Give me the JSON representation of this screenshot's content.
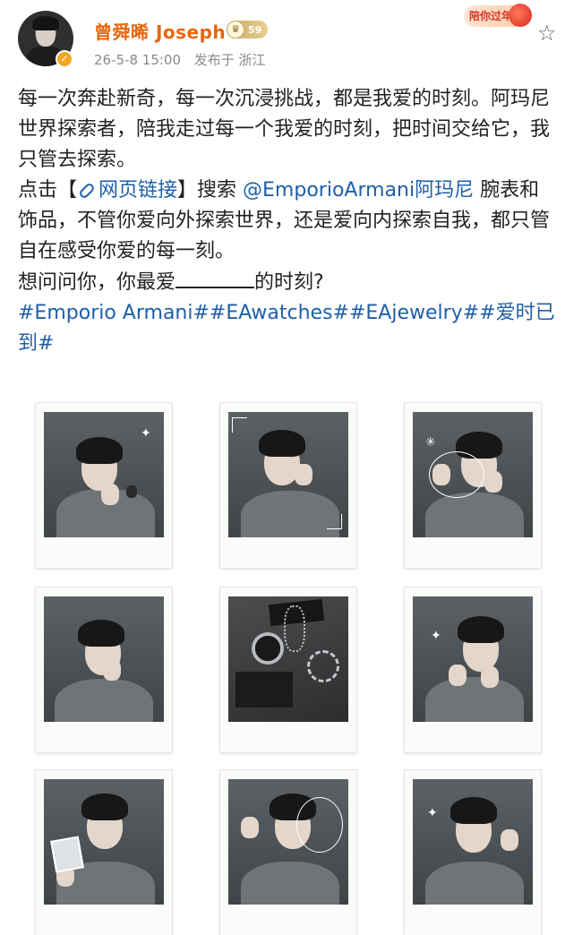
{
  "post": {
    "username": "曾舜晞 Joseph",
    "level": "59",
    "verified_symbol": "✓",
    "festival_badge": "陪你过年",
    "favorite_symbol": "☆",
    "timestamp": "26-5-8 15:00",
    "location": "发布于 浙江",
    "paragraph1": "每一次奔赴新奇，每一次沉浸挑战，都是我爱的时刻。阿玛尼世界探索者，陪我走过每一个我爱的时刻，把时间交给它，我只管去探索。",
    "p2_prefix": "点击【",
    "p2_link_text": "网页链接",
    "p2_mid": "】搜索 ",
    "p2_mention": "@EmporioArmani阿玛尼",
    "p2_suffix": " 腕表和饰品，不管你爱向外探索世界，还是爱向内探索自我，都只管自在感受你爱的每一刻。",
    "p3_prefix": "想问问你，你最爱",
    "p3_suffix": "的时刻?",
    "hashtags": "#Emporio Armani##EAwatches##EAjewelry##爱时已到#"
  },
  "photos": [
    {
      "alt": "portrait-1"
    },
    {
      "alt": "portrait-2"
    },
    {
      "alt": "portrait-3"
    },
    {
      "alt": "portrait-4"
    },
    {
      "alt": "products"
    },
    {
      "alt": "portrait-6"
    },
    {
      "alt": "portrait-7"
    },
    {
      "alt": "portrait-8"
    },
    {
      "alt": "portrait-9"
    }
  ],
  "colors": {
    "username": "#e8660c",
    "link": "#1f5fa8",
    "meta": "#8a8a8a"
  }
}
